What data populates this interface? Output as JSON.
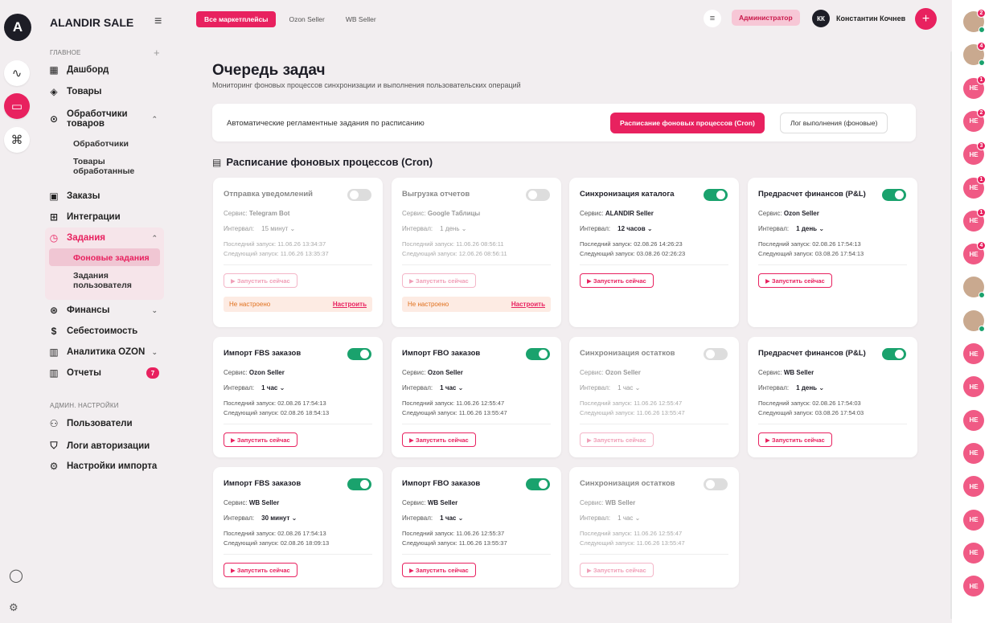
{
  "rail": {
    "logo_letter": "A",
    "icons": [
      "activity-icon",
      "briefcase-icon",
      "command-icon"
    ],
    "bottom_icons": [
      "chat-icon",
      "gear-icon"
    ]
  },
  "sidebar": {
    "brand": "ALANDIR SALE",
    "section_main": "ГЛАВНОЕ",
    "items": [
      {
        "label": "Дашборд",
        "icon": "▦"
      },
      {
        "label": "Товары",
        "icon": "◈"
      },
      {
        "label": "Обработчики товаров",
        "icon": "⊙",
        "chevron": "⌃"
      }
    ],
    "handlers_sub": [
      "Обработчики",
      "Товары обработанные"
    ],
    "items2": [
      {
        "label": "Заказы",
        "icon": "▣"
      },
      {
        "label": "Интеграции",
        "icon": "⊞"
      },
      {
        "label": "Задания",
        "icon": "◷",
        "chevron": "⌃"
      }
    ],
    "tasks_sub": [
      "Фоновые задания",
      "Задания пользователя"
    ],
    "items3": [
      {
        "label": "Финансы",
        "icon": "⊛",
        "chevron": "⌄"
      },
      {
        "label": "Себестоимость",
        "icon": "$"
      },
      {
        "label": "Аналитика OZON",
        "icon": "▥",
        "chevron": "⌄"
      },
      {
        "label": "Отчеты",
        "icon": "▥",
        "badge": "7"
      }
    ],
    "section_admin": "АДМИН. НАСТРОЙКИ",
    "admin_items": [
      {
        "label": "Пользователи",
        "icon": "⚇"
      },
      {
        "label": "Логи авторизации",
        "icon": "⛉"
      },
      {
        "label": "Настройки импорта",
        "icon": "⚙"
      }
    ]
  },
  "topbar": {
    "chips": [
      "Все маркетплейсы",
      "Ozon Seller",
      "WB Seller"
    ],
    "role": "Администратор",
    "user_initials": "КК",
    "user_name": "Константин Кочнев"
  },
  "page": {
    "title": "Очередь задач",
    "subtitle": "Мониторинг фоновых процессов синхронизации и выполнения пользовательских операций",
    "panel_label": "Автоматические регламентные задания по расписанию",
    "tab_active": "Расписание фоновых процессов (Cron)",
    "tab_other": "Лог выполнения (фоновые)",
    "section_title": "Расписание фоновых процессов (Cron)"
  },
  "labels": {
    "service": "Сервис:",
    "interval": "Интервал:",
    "last": "Последний запуск:",
    "next": "Следующий запуск:",
    "run": "Запустить сейчас",
    "not_configured": "Не настроено",
    "configure": "Настроить"
  },
  "cards": [
    {
      "title": "Отправка уведомлений",
      "on": false,
      "service": "Telegram Bot",
      "interval": "15 минут",
      "last": "11.06.26 13:34:37",
      "next": "11.06.26 13:35:37",
      "warn": true
    },
    {
      "title": "Выгрузка отчетов",
      "on": false,
      "service": "Google Таблицы",
      "interval": "1 день",
      "last": "11.06.26 08:56:11",
      "next": "12.06.26 08:56:11",
      "warn": true
    },
    {
      "title": "Синхронизация каталога",
      "on": true,
      "service": "ALANDIR Seller",
      "interval": "12 часов",
      "last": "02.08.26 14:26:23",
      "next": "03.08.26 02:26:23",
      "warn": false
    },
    {
      "title": "Предрасчет финансов (P&L)",
      "on": true,
      "service": "Ozon Seller",
      "interval": "1 день",
      "last": "02.08.26 17:54:13",
      "next": "03.08.26 17:54:13",
      "warn": false
    },
    {
      "title": "Импорт FBS заказов",
      "on": true,
      "service": "Ozon Seller",
      "interval": "1 час",
      "last": "02.08.26 17:54:13",
      "next": "02.08.26 18:54:13",
      "warn": false
    },
    {
      "title": "Импорт FBO заказов",
      "on": true,
      "service": "Ozon Seller",
      "interval": "1 час",
      "last": "11.06.26 12:55:47",
      "next": "11.06.26 13:55:47",
      "warn": false
    },
    {
      "title": "Синхронизация остатков",
      "on": false,
      "service": "Ozon Seller",
      "interval": "1 час",
      "last": "11.06.26 12:55:47",
      "next": "11.06.26 13:55:47",
      "warn": false
    },
    {
      "title": "Предрасчет финансов (P&L)",
      "on": true,
      "service": "WB Seller",
      "interval": "1 день",
      "last": "02.08.26 17:54:03",
      "next": "03.08.26 17:54:03",
      "warn": false
    },
    {
      "title": "Импорт FBS заказов",
      "on": true,
      "service": "WB Seller",
      "interval": "30 минут",
      "last": "02.08.26 17:54:13",
      "next": "02.08.26 18:09:13",
      "warn": false
    },
    {
      "title": "Импорт FBO заказов",
      "on": true,
      "service": "WB Seller",
      "interval": "1 час",
      "last": "11.06.26 12:55:37",
      "next": "11.06.26 13:55:37",
      "warn": false
    },
    {
      "title": "Синхронизация остатков",
      "on": false,
      "service": "WB Seller",
      "interval": "1 час",
      "last": "11.06.26 12:55:47",
      "next": "11.06.26 13:55:47",
      "warn": false
    }
  ],
  "contacts": [
    {
      "type": "photo",
      "badge": "2",
      "online": true
    },
    {
      "type": "photo",
      "badge": "4",
      "online": true
    },
    {
      "type": "initials",
      "text": "НЕ",
      "badge": "1"
    },
    {
      "type": "initials",
      "text": "НЕ",
      "badge": "2"
    },
    {
      "type": "initials",
      "text": "НЕ",
      "badge": "3"
    },
    {
      "type": "initials",
      "text": "НЕ",
      "badge": "1"
    },
    {
      "type": "initials",
      "text": "НЕ",
      "badge": "1"
    },
    {
      "type": "initials",
      "text": "НЕ",
      "badge": "4"
    },
    {
      "type": "photo",
      "online": true
    },
    {
      "type": "photo",
      "online": true
    },
    {
      "type": "initials",
      "text": "НЕ"
    },
    {
      "type": "initials",
      "text": "НЕ"
    },
    {
      "type": "initials",
      "text": "НЕ"
    },
    {
      "type": "initials",
      "text": "НЕ"
    },
    {
      "type": "initials",
      "text": "НЕ"
    },
    {
      "type": "initials",
      "text": "НЕ"
    },
    {
      "type": "initials",
      "text": "НЕ"
    },
    {
      "type": "initials",
      "text": "НЕ"
    }
  ]
}
